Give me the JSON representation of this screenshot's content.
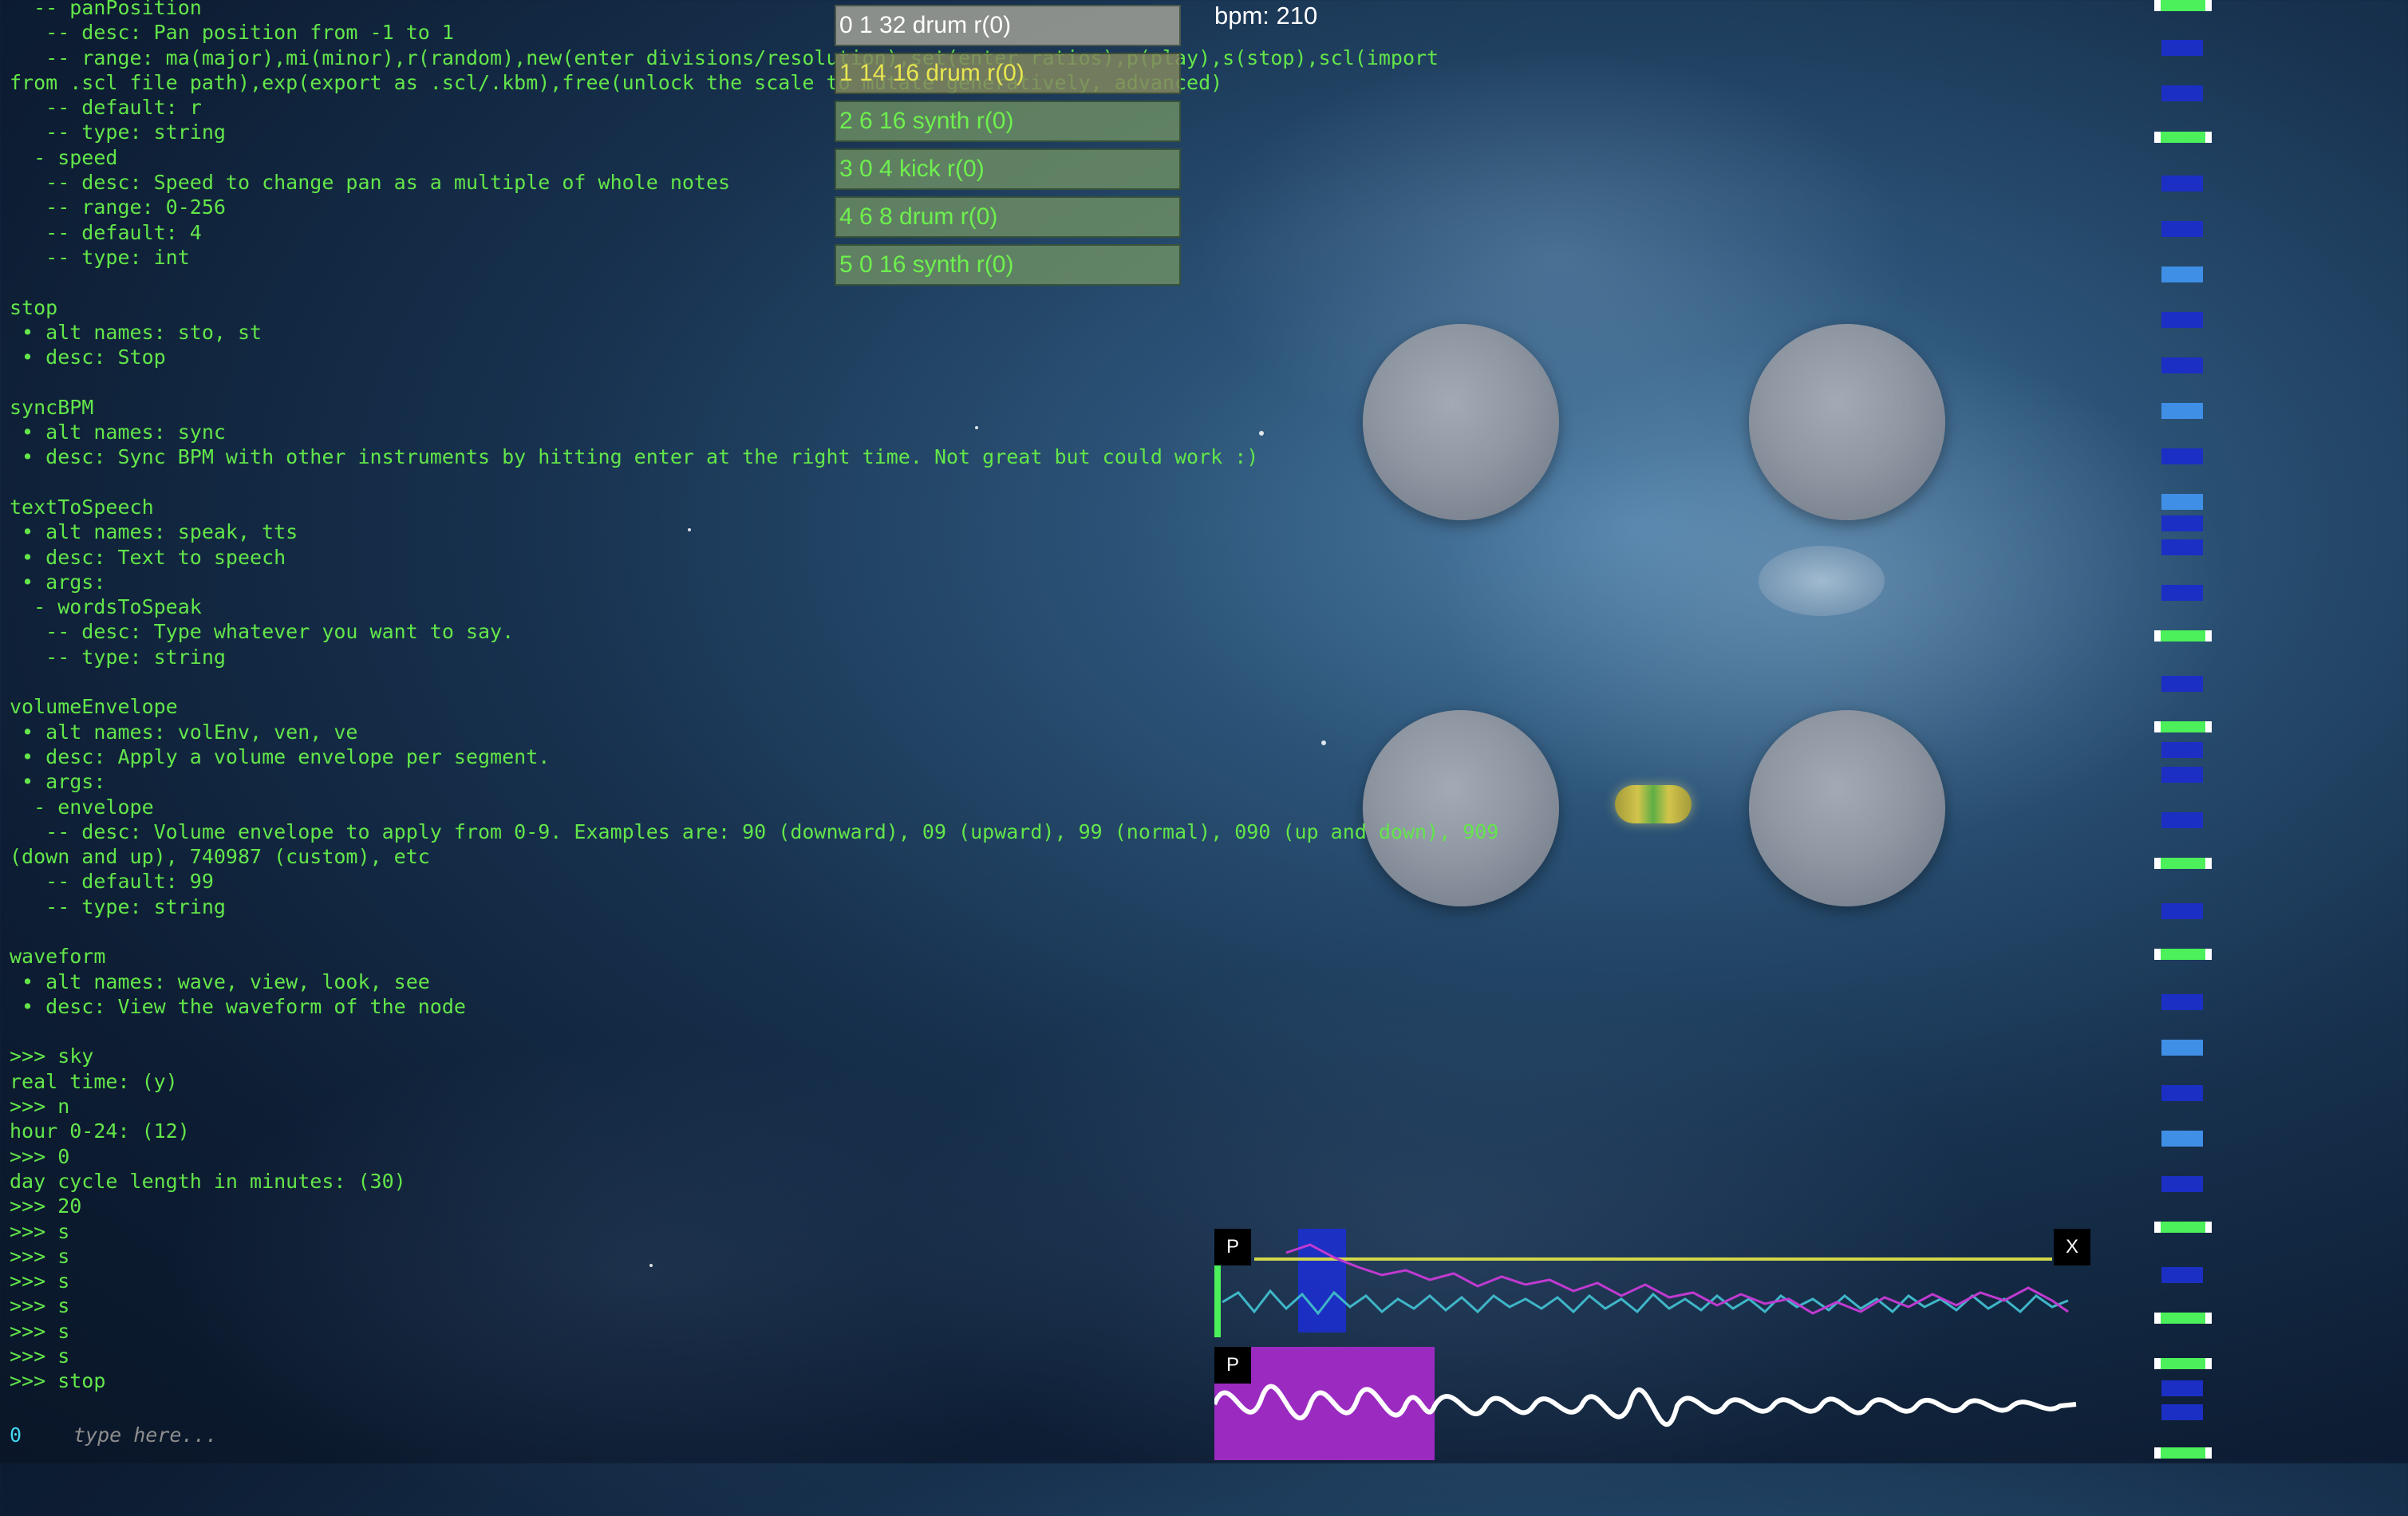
{
  "terminal": {
    "lines": [
      "  -- panPosition",
      "   -- desc: Pan position from -1 to 1",
      "   -- range: ma(major),mi(minor),r(random),new(enter divisions/resolution),set(enter ratios),p(play),s(stop),scl(import",
      "from .scl file path),exp(export as .scl/.kbm),free(unlock the scale to mutate generatively, advanced)",
      "   -- default: r",
      "   -- type: string",
      "  - speed",
      "   -- desc: Speed to change pan as a multiple of whole notes",
      "   -- range: 0-256",
      "   -- default: 4",
      "   -- type: int",
      "",
      "stop",
      " • alt names: sto, st",
      " • desc: Stop",
      "",
      "syncBPM",
      " • alt names: sync",
      " • desc: Sync BPM with other instruments by hitting enter at the right time. Not great but could work :)",
      "",
      "textToSpeech",
      " • alt names: speak, tts",
      " • desc: Text to speech",
      " • args:",
      "  - wordsToSpeak",
      "   -- desc: Type whatever you want to say.",
      "   -- type: string",
      "",
      "volumeEnvelope",
      " • alt names: volEnv, ven, ve",
      " • desc: Apply a volume envelope per segment.",
      " • args:",
      "  - envelope",
      "   -- desc: Volume envelope to apply from 0-9. Examples are: 90 (downward), 09 (upward), 99 (normal), 090 (up and down), 909",
      "(down and up), 740987 (custom), etc",
      "   -- default: 99",
      "   -- type: string",
      "",
      "waveform",
      " • alt names: wave, view, look, see",
      " • desc: View the waveform of the node",
      "",
      ">>> sky",
      "real time: (y)",
      ">>> n",
      "hour 0-24: (12)",
      ">>> 0",
      "day cycle length in minutes: (30)",
      ">>> 20",
      ">>> s",
      ">>> s",
      ">>> s",
      ">>> s",
      ">>> s",
      ">>> s",
      ">>> stop"
    ],
    "input_count": "0",
    "input_placeholder": "type here..."
  },
  "tracks": [
    "0 1 32 drum r(0)",
    "1 14 16 drum r(0)",
    "2 6 16 synth r(0)",
    "3 0 4 kick r(0)",
    "4 6 8 drum r(0)",
    "5 0 16 synth r(0)"
  ],
  "bpm_label": "bpm: 210",
  "waveform": {
    "play_label": "P",
    "close_label": "X",
    "play2_label": "P"
  },
  "colors": {
    "terminal_text": "#63e64a",
    "input_count": "#43d6f0",
    "sidebar_marker": "#1b2fc4",
    "sidebar_active": "#4cf05a",
    "waveform_highlight": "#9b2bc0"
  }
}
